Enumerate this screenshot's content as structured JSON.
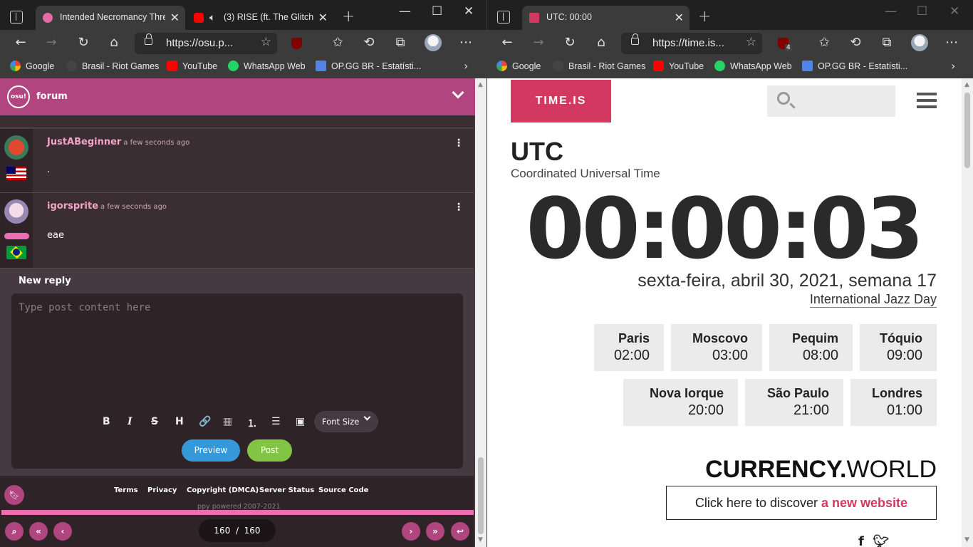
{
  "left_window": {
    "tabs": [
      {
        "title": "Intended Necromancy Thre",
        "active": true
      },
      {
        "title": "(3) RISE (ft. The Glitch",
        "active": false
      }
    ],
    "url": "https://osu.p...",
    "bookmarks": [
      "Google",
      "Brasil - Riot Games",
      "YouTube",
      "WhatsApp Web",
      "OP.GG BR - Estatísti..."
    ],
    "forum": {
      "logo": "osu!",
      "title": "forum",
      "posts": [
        {
          "user": "JustABeginner",
          "time": "a few seconds ago",
          "body": "."
        },
        {
          "user": "igorsprite",
          "time": "a few seconds ago",
          "body": "eae"
        }
      ],
      "reply": {
        "label": "New reply",
        "placeholder": "Type post content here",
        "toolbar": {
          "bold": "B",
          "italic": "I",
          "strike": "S",
          "heading": "H",
          "link": "🔗",
          "box": "▦",
          "olist": "⒈",
          "ulist": "☰",
          "image": "▣"
        },
        "font_size_label": "Font Size",
        "preview_label": "Preview",
        "post_label": "Post"
      },
      "footer": {
        "links": [
          "Terms",
          "Privacy",
          "Copyright (DMCA)",
          "Server Status",
          "Source Code"
        ],
        "copyright": "ppy powered 2007-2021"
      },
      "pager": {
        "current": "160",
        "separator": "/",
        "total": "160"
      }
    }
  },
  "right_window": {
    "tabs": [
      {
        "title": "UTC: 00:00",
        "active": true
      }
    ],
    "url": "https://time.is...",
    "extension_badge": "4",
    "bookmarks": [
      "Google",
      "Brasil - Riot Games",
      "YouTube",
      "WhatsApp Web",
      "OP.GG BR - Estatísti..."
    ],
    "timeis": {
      "logo": "TIME.IS",
      "zone": "UTC",
      "zone_name": "Coordinated Universal Time",
      "clock": "00:00:03",
      "date": "sexta-feira, abril 30, 2021, semana 17",
      "holiday": "International Jazz Day",
      "cities_row1": [
        {
          "name": "Paris",
          "time": "02:00"
        },
        {
          "name": "Moscovo",
          "time": "03:00"
        },
        {
          "name": "Pequim",
          "time": "08:00"
        },
        {
          "name": "Tóquio",
          "time": "09:00"
        }
      ],
      "cities_row2": [
        {
          "name": "Nova Iorque",
          "time": "20:00"
        },
        {
          "name": "São Paulo",
          "time": "21:00"
        },
        {
          "name": "Londres",
          "time": "01:00"
        }
      ],
      "currency_brand_bold": "CURRENCY.",
      "currency_brand_light": "WORLD",
      "discover_text": "Click here to discover",
      "discover_link": "a new website"
    }
  },
  "colors": {
    "osu_pink": "#b0457f",
    "timeis_red": "#d33861",
    "preview_blue": "#3598d8",
    "post_green": "#82c445"
  }
}
